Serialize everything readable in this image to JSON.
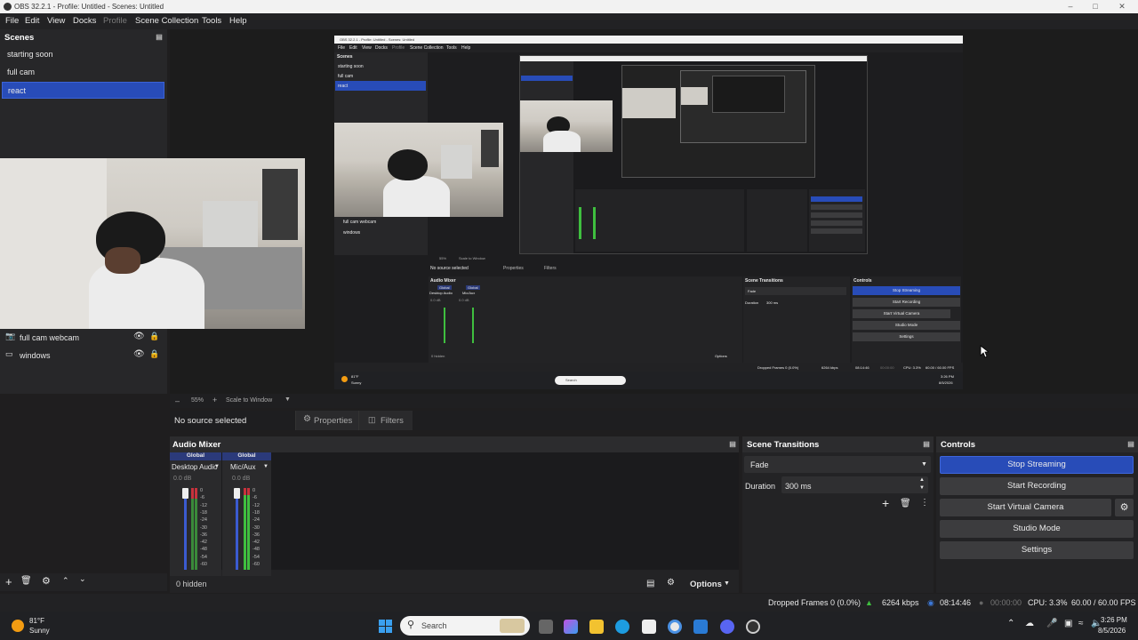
{
  "window": {
    "title": "OBS 32.2.1 - Profile: Untitled - Scenes: Untitled"
  },
  "menu": [
    "File",
    "Edit",
    "View",
    "Docks",
    "Profile",
    "Scene Collection",
    "Tools",
    "Help"
  ],
  "scenes": {
    "title": "Scenes",
    "items": [
      {
        "label": "starting soon",
        "selected": false
      },
      {
        "label": "full cam",
        "selected": false
      },
      {
        "label": "react",
        "selected": true
      }
    ]
  },
  "sources": {
    "items": [
      {
        "label": "full cam webcam",
        "icon": "camera-icon"
      },
      {
        "label": "windows",
        "icon": "window-capture-icon"
      }
    ]
  },
  "preview_footer": {
    "zoom": "55%",
    "scale_mode": "Scale to Window"
  },
  "properties_bar": {
    "no_source": "No source selected",
    "properties": "Properties",
    "filters": "Filters"
  },
  "audio_mixer": {
    "title": "Audio Mixer",
    "channels": [
      {
        "badge": "Global",
        "name": "Desktop Audio",
        "db": "0.0 dB"
      },
      {
        "badge": "Global",
        "name": "Mic/Aux",
        "db": "0.0 dB"
      }
    ],
    "scale": [
      "0",
      "-6",
      "-12",
      "-18",
      "-24",
      "-30",
      "-36",
      "-42",
      "-48",
      "-54",
      "-60"
    ],
    "hidden": "0 hidden",
    "options": "Options"
  },
  "scene_transitions": {
    "title": "Scene Transitions",
    "transition": "Fade",
    "duration_label": "Duration",
    "duration_value": "300 ms"
  },
  "controls": {
    "title": "Controls",
    "buttons": {
      "stop_streaming": "Stop Streaming",
      "start_recording": "Start Recording",
      "start_virtual_camera": "Start Virtual Camera",
      "studio_mode": "Studio Mode",
      "settings": "Settings"
    }
  },
  "status": {
    "dropped_frames": "Dropped Frames 0 (0.0%)",
    "bitrate": "6264 kbps",
    "stream_time": "08:14:46",
    "record_time": "00:00:00",
    "cpu": "CPU: 3.3%",
    "fps": "60.00 / 60.00 FPS"
  },
  "taskbar": {
    "weather_temp": "81°F",
    "weather_desc": "Sunny",
    "search_placeholder": "Search",
    "time": "3:26 PM",
    "date": "8/5/2026"
  },
  "nested_capture": {
    "title": "OBS 32.2.1 - Profile: Untitled - Scenes: Untitled",
    "menu": [
      "File",
      "Edit",
      "View",
      "Docks",
      "Profile",
      "Scene Collection",
      "Tools",
      "Help"
    ],
    "scenes_title": "Scenes",
    "scenes": [
      "starting soon",
      "full cam",
      "react"
    ],
    "sources": [
      "full cam webcam",
      "windows"
    ],
    "zoom": "55%",
    "scale_mode": "Scale to Window",
    "no_source": "No source selected",
    "properties": "Properties",
    "filters": "Filters",
    "mixer_title": "Audio Mixer",
    "channels": [
      {
        "badge": "Global",
        "name": "Desktop Audio",
        "db": "0.0 dB"
      },
      {
        "badge": "Global",
        "name": "Mic/Aux",
        "db": "0.0 dB"
      }
    ],
    "hidden": "0 hidden",
    "options": "Options",
    "transitions_title": "Scene Transitions",
    "transition": "Fade",
    "duration_label": "Duration",
    "duration_value": "300 ms",
    "controls_title": "Controls",
    "buttons": [
      "Stop Streaming",
      "Start Recording",
      "Start Virtual Camera",
      "Studio Mode",
      "Settings"
    ],
    "dropped": "Dropped Frames 0 (0.0%)",
    "bitrate": "6264 kbps",
    "stream_time": "08:14:46",
    "record_time": "00:00:00",
    "cpu": "CPU: 3.3%",
    "fps": "60.00 / 60.00 FPS",
    "weather_temp": "81°F",
    "weather_desc": "Sunny",
    "search": "Search",
    "time": "3:26 PM",
    "date": "8/5/2026"
  },
  "colors": {
    "accent": "#284cb8",
    "panel": "#272729",
    "background": "#1f1e1f",
    "meter_green": "#3fbf3f",
    "meter_red": "#c8323c"
  }
}
